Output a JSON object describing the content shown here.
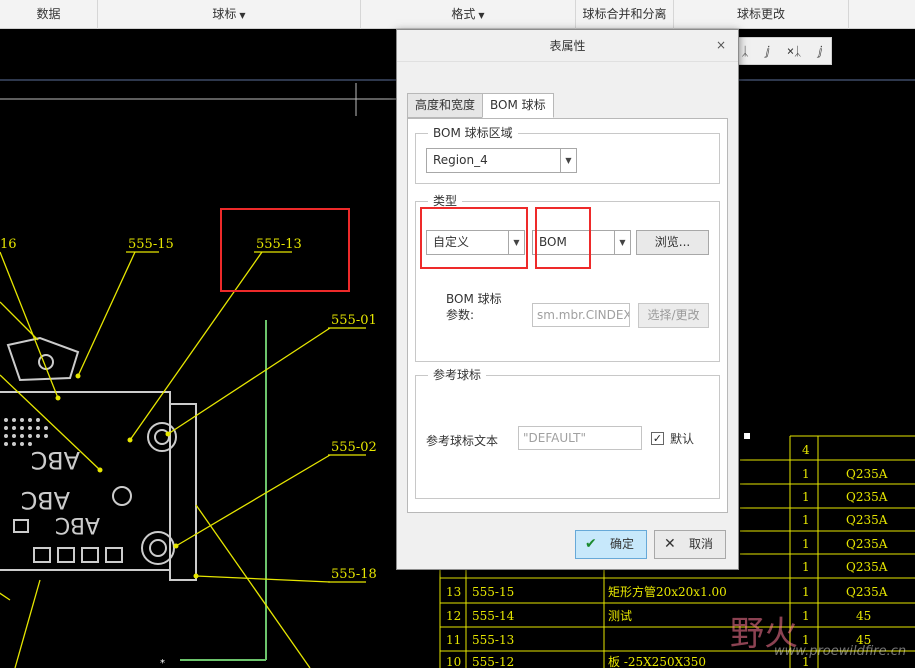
{
  "ribbon": {
    "groups": [
      {
        "label": "数据",
        "caret": ""
      },
      {
        "label": "球标",
        "caret": "▼"
      },
      {
        "label": "格式",
        "caret": "▼"
      },
      {
        "label": "球标合并和分离",
        "caret": ""
      },
      {
        "label": "球标更改",
        "caret": ""
      }
    ]
  },
  "minitool": {
    "items": [
      "ᛣ",
      "ⅉ",
      "×ᛣ",
      "ⅉ"
    ]
  },
  "drawing": {
    "balloon_labels": [
      "16",
      "555-15",
      "555-13",
      "555-01",
      "555-02",
      "555-18"
    ],
    "part_text": [
      "ABC",
      "ABC",
      "ABC"
    ],
    "table_rows": [
      {
        "c1": "",
        "c2": "",
        "c3": "",
        "c4": "4",
        "c5": ""
      },
      {
        "c1": "",
        "c2": "",
        "c3": "",
        "c4": "1",
        "c5": "Q235A"
      },
      {
        "c1": "",
        "c2": "",
        "c3": "",
        "c4": "1",
        "c5": "Q235A"
      },
      {
        "c1": "",
        "c2": "",
        "c3": "",
        "c4": "1",
        "c5": "Q235A"
      },
      {
        "c1": "",
        "c2": "",
        "c3": "",
        "c4": "1",
        "c5": "Q235A"
      },
      {
        "c1": "",
        "c2": "",
        "c3": "",
        "c4": "1",
        "c5": "Q235A"
      },
      {
        "c1": "13",
        "c2": "555-15",
        "c3": "矩形方管20x20x1.00",
        "c4": "1",
        "c5": "Q235A"
      },
      {
        "c1": "12",
        "c2": "555-14",
        "c3": "测试",
        "c4": "1",
        "c5": "45"
      },
      {
        "c1": "11",
        "c2": "555-13",
        "c3": "",
        "c4": "1",
        "c5": "45"
      },
      {
        "c1": "10",
        "c2": "555-12",
        "c3": "板 -25X250X350",
        "c4": "1",
        "c5": ""
      }
    ]
  },
  "dialog": {
    "title": "表属性",
    "close": "×",
    "tabs": [
      "高度和宽度",
      "BOM 球标"
    ],
    "bom_region": {
      "legend": "BOM 球标区域",
      "value": "Region_4"
    },
    "type": {
      "legend": "类型",
      "type_value": "自定义",
      "source_value": "BOM",
      "browse_label": "浏览...",
      "param_label_line1": "BOM 球标",
      "param_label_line2": "参数:",
      "param_value": "sm.mbr.CINDEX",
      "select_label": "选择/更改"
    },
    "reference": {
      "legend": "参考球标",
      "text_label": "参考球标文本",
      "text_value": "\"DEFAULT\"",
      "default_label": "默认",
      "default_checked": "✓"
    },
    "ok_label": "确定",
    "cancel_label": "取消"
  },
  "watermark": {
    "big": "野火",
    "url": "www.proewildfire.cn"
  },
  "colors": {
    "cad_bg": "#000000",
    "leader": "#e6e600",
    "annotation": "#ee2a2a"
  }
}
